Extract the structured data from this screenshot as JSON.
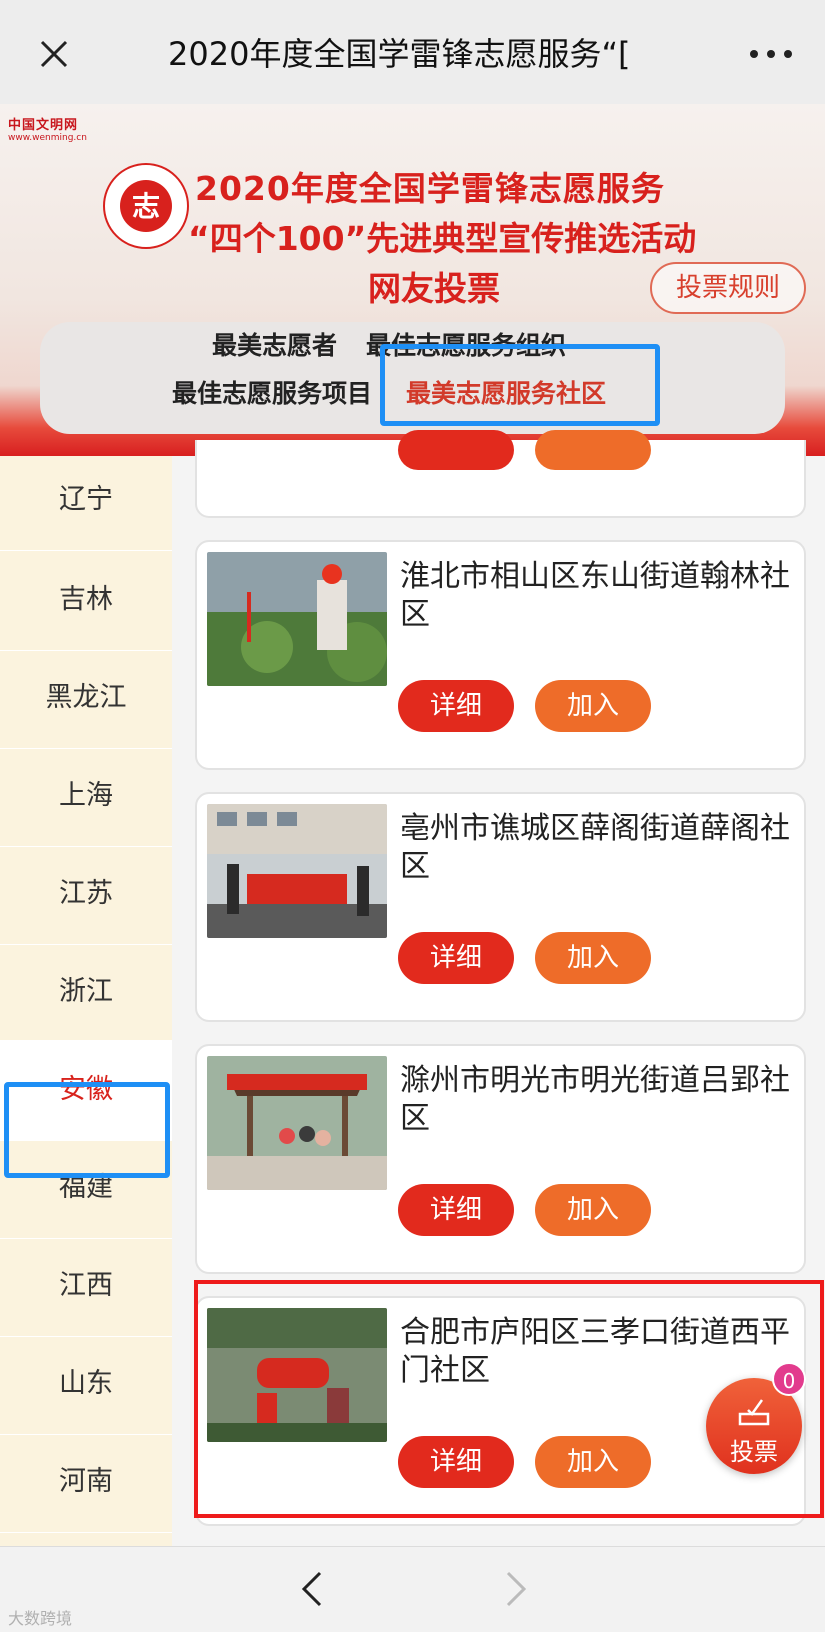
{
  "topbar": {
    "title": "2020年度全国学雷锋志愿服务“["
  },
  "banner": {
    "brand_name": "中国文明网",
    "brand_url": "www.wenming.cn",
    "emblem_text": "中国志愿服务",
    "title_line1": "2020年度全国学雷锋志愿服务",
    "title_line2": "“四个100”先进典型宣传推选活动",
    "title_line3": "网友投票",
    "rules_button": "投票规则"
  },
  "categories": [
    {
      "label": "最美志愿者",
      "active": false
    },
    {
      "label": "最佳志愿服务组织",
      "active": false
    },
    {
      "label": "最佳志愿服务项目",
      "active": false
    },
    {
      "label": "最美志愿服务社区",
      "active": true
    }
  ],
  "sidebar": {
    "items": [
      {
        "label": "辽宁",
        "active": false
      },
      {
        "label": "吉林",
        "active": false
      },
      {
        "label": "黑龙江",
        "active": false
      },
      {
        "label": "上海",
        "active": false
      },
      {
        "label": "江苏",
        "active": false
      },
      {
        "label": "浙江",
        "active": false
      },
      {
        "label": "安徽",
        "active": true
      },
      {
        "label": "福建",
        "active": false
      },
      {
        "label": "江西",
        "active": false
      },
      {
        "label": "山东",
        "active": false
      },
      {
        "label": "河南",
        "active": false
      }
    ]
  },
  "buttons": {
    "detail": "详细",
    "join": "加入"
  },
  "items": [
    {
      "title": "淮北市相山区东山街道翰林社区"
    },
    {
      "title": "亳州市谯城区薛阁街道薛阁社区"
    },
    {
      "title": "滁州市明光市明光街道吕郢社区"
    },
    {
      "title": "合肥市庐阳区三孝口街道西平门社区"
    }
  ],
  "vote": {
    "label": "投票",
    "count": "0"
  },
  "watermark": "大数跨境",
  "colors": {
    "accent_red": "#e22a1d",
    "accent_orange": "#ee6c29",
    "highlight_blue": "#1e8ff5",
    "highlight_red": "#ee1b1b"
  }
}
